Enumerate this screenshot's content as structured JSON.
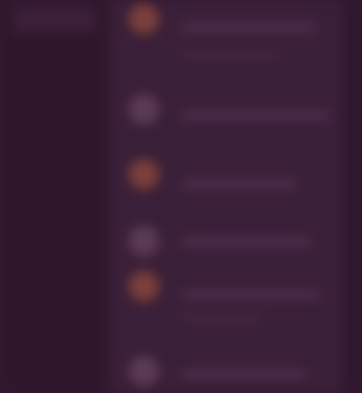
{
  "sidebar": {
    "header_label": ""
  },
  "list": {
    "items": [
      {
        "title": "",
        "subtitle": "",
        "avatar_color": "#7a3f3a"
      },
      {
        "title": "",
        "subtitle": "",
        "avatar_color": "#5a3a55"
      },
      {
        "title": "",
        "subtitle": "",
        "avatar_color": "#7a3f3a"
      },
      {
        "title": "",
        "subtitle": "",
        "avatar_color": "#5a3a55"
      },
      {
        "title": "",
        "subtitle": "",
        "avatar_color": "#7a3f3a"
      },
      {
        "title": "",
        "subtitle": "",
        "avatar_color": "#5a3a55"
      }
    ]
  },
  "colors": {
    "background": "#331a30",
    "sidebar": "#2f172b",
    "list": "#3a1f38",
    "accent_orange": "#7a3f3a",
    "accent_purple": "#5a3a55"
  }
}
